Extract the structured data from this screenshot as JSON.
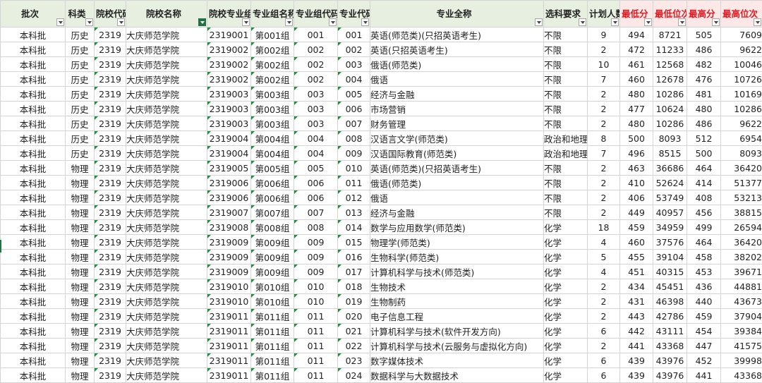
{
  "headers": [
    {
      "label": "批次",
      "filter": false,
      "red": false
    },
    {
      "label": "科类",
      "filter": false,
      "red": false
    },
    {
      "label": "院校代码",
      "filter": false,
      "red": false
    },
    {
      "label": "院校名称",
      "filter": true,
      "red": false
    },
    {
      "label": "院校专业组代码",
      "filter": false,
      "red": false
    },
    {
      "label": "专业组名称",
      "filter": false,
      "red": false
    },
    {
      "label": "专业组代码",
      "filter": false,
      "red": false
    },
    {
      "label": "专业代码",
      "filter": false,
      "red": false
    },
    {
      "label": "专业全称",
      "filter": false,
      "red": false
    },
    {
      "label": "选科要求",
      "filter": false,
      "red": false
    },
    {
      "label": "计划人数",
      "filter": false,
      "red": false
    },
    {
      "label": "最低分",
      "filter": false,
      "red": true
    },
    {
      "label": "最低位次",
      "filter": false,
      "red": true
    },
    {
      "label": "最高分",
      "filter": false,
      "red": true
    },
    {
      "label": "最高位次",
      "filter": false,
      "red": true
    }
  ],
  "rows": [
    [
      "本科批",
      "历史",
      "2319",
      "大庆师范学院",
      "2319001",
      "第001组",
      "001",
      "001",
      "英语(师范类)(只招英语考生)",
      "不限",
      "9",
      "494",
      "8721",
      "505",
      "7609"
    ],
    [
      "本科批",
      "历史",
      "2319",
      "大庆师范学院",
      "2319002",
      "第002组",
      "002",
      "002",
      "英语(只招英语考生)",
      "不限",
      "2",
      "472",
      "11233",
      "486",
      "9622"
    ],
    [
      "本科批",
      "历史",
      "2319",
      "大庆师范学院",
      "2319002",
      "第002组",
      "002",
      "003",
      "俄语(师范类)",
      "不限",
      "10",
      "461",
      "12568",
      "482",
      "10046"
    ],
    [
      "本科批",
      "历史",
      "2319",
      "大庆师范学院",
      "2319002",
      "第002组",
      "002",
      "004",
      "俄语",
      "不限",
      "7",
      "460",
      "12678",
      "476",
      "10726"
    ],
    [
      "本科批",
      "历史",
      "2319",
      "大庆师范学院",
      "2319003",
      "第003组",
      "003",
      "005",
      "经济与金融",
      "不限",
      "2",
      "480",
      "10286",
      "481",
      "10169"
    ],
    [
      "本科批",
      "历史",
      "2319",
      "大庆师范学院",
      "2319003",
      "第003组",
      "003",
      "006",
      "市场营销",
      "不限",
      "2",
      "477",
      "10624",
      "480",
      "10286"
    ],
    [
      "本科批",
      "历史",
      "2319",
      "大庆师范学院",
      "2319003",
      "第003组",
      "003",
      "007",
      "财务管理",
      "不限",
      "2",
      "480",
      "10286",
      "486",
      "9622"
    ],
    [
      "本科批",
      "历史",
      "2319",
      "大庆师范学院",
      "2319004",
      "第004组",
      "004",
      "008",
      "汉语言文学(师范类)",
      "政治和地理",
      "8",
      "500",
      "8093",
      "512",
      "6954"
    ],
    [
      "本科批",
      "历史",
      "2319",
      "大庆师范学院",
      "2319004",
      "第004组",
      "004",
      "009",
      "汉语国际教育(师范类)",
      "政治和地理",
      "7",
      "496",
      "8515",
      "500",
      "8093"
    ],
    [
      "本科批",
      "物理",
      "2319",
      "大庆师范学院",
      "2319005",
      "第005组",
      "005",
      "010",
      "英语(师范类)(只招英语考生)",
      "不限",
      "2",
      "463",
      "36686",
      "464",
      "36420"
    ],
    [
      "本科批",
      "物理",
      "2319",
      "大庆师范学院",
      "2319006",
      "第006组",
      "006",
      "011",
      "俄语(师范类)",
      "不限",
      "2",
      "410",
      "52624",
      "414",
      "51377"
    ],
    [
      "本科批",
      "物理",
      "2319",
      "大庆师范学院",
      "2319006",
      "第006组",
      "006",
      "012",
      "俄语",
      "不限",
      "2",
      "406",
      "53749",
      "408",
      "53213"
    ],
    [
      "本科批",
      "物理",
      "2319",
      "大庆师范学院",
      "2319007",
      "第007组",
      "007",
      "013",
      "经济与金融",
      "不限",
      "2",
      "449",
      "40957",
      "456",
      "38815"
    ],
    [
      "本科批",
      "物理",
      "2319",
      "大庆师范学院",
      "2319008",
      "第008组",
      "008",
      "014",
      "数学与应用数学(师范类)",
      "化学",
      "18",
      "459",
      "34959",
      "499",
      "26594"
    ],
    [
      "本科批",
      "物理",
      "2319",
      "大庆师范学院",
      "2319009",
      "第009组",
      "009",
      "015",
      "物理学(师范类)",
      "化学",
      "4",
      "460",
      "37576",
      "464",
      "36420"
    ],
    [
      "本科批",
      "物理",
      "2319",
      "大庆师范学院",
      "2319009",
      "第009组",
      "009",
      "016",
      "生物科学(师范类)",
      "化学",
      "5",
      "455",
      "39104",
      "458",
      "38202"
    ],
    [
      "本科批",
      "物理",
      "2319",
      "大庆师范学院",
      "2319009",
      "第009组",
      "009",
      "017",
      "计算机科学与技术(师范类)",
      "化学",
      "4",
      "451",
      "40315",
      "453",
      "39671"
    ],
    [
      "本科批",
      "物理",
      "2319",
      "大庆师范学院",
      "2319010",
      "第010组",
      "010",
      "018",
      "生物技术",
      "化学",
      "2",
      "434",
      "45451",
      "436",
      "44881"
    ],
    [
      "本科批",
      "物理",
      "2319",
      "大庆师范学院",
      "2319010",
      "第010组",
      "010",
      "019",
      "生物制药",
      "化学",
      "2",
      "431",
      "46398",
      "440",
      "43673"
    ],
    [
      "本科批",
      "物理",
      "2319",
      "大庆师范学院",
      "2319011",
      "第011组",
      "011",
      "020",
      "电子信息工程",
      "化学",
      "2",
      "443",
      "42786",
      "459",
      "37904"
    ],
    [
      "本科批",
      "物理",
      "2319",
      "大庆师范学院",
      "2319011",
      "第011组",
      "011",
      "021",
      "计算机科学与技术(软件开发方向)",
      "化学",
      "6",
      "442",
      "43111",
      "454",
      "39384"
    ],
    [
      "本科批",
      "物理",
      "2319",
      "大庆师范学院",
      "2319011",
      "第011组",
      "011",
      "022",
      "计算机科学与技术(云服务与虚拟化方向)",
      "化学",
      "2",
      "441",
      "43368",
      "447",
      "41575"
    ],
    [
      "本科批",
      "物理",
      "2319",
      "大庆师范学院",
      "2319011",
      "第011组",
      "011",
      "023",
      "数字媒体技术",
      "化学",
      "6",
      "439",
      "43976",
      "452",
      "39998"
    ],
    [
      "本科批",
      "物理",
      "2319",
      "大庆师范学院",
      "2319011",
      "第011组",
      "011",
      "024",
      "数据科学与大数据技术",
      "化学",
      "6",
      "439",
      "43976",
      "441",
      "43368"
    ]
  ],
  "colors": {
    "header_bg": "#e6efe0",
    "red_header_bg": "#fde8e8",
    "red_text": "#e0191f",
    "filter_active": "#217346",
    "green_triangle": "#1e8e3e"
  }
}
